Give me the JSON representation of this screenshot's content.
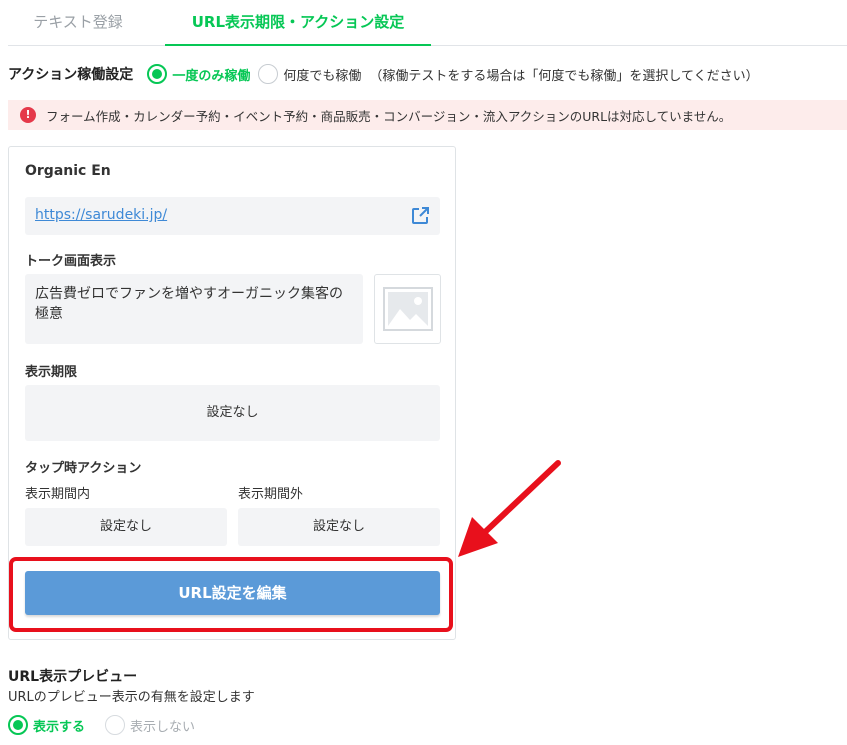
{
  "tabs": [
    {
      "label": "テキスト登録",
      "active": false
    },
    {
      "label": "URL表示期限・アクション設定",
      "active": true
    }
  ],
  "action_setting": {
    "title": "アクション稼働設定",
    "options": [
      {
        "label": "一度のみ稼働",
        "selected": true
      },
      {
        "label": "何度でも稼働",
        "selected": false
      }
    ],
    "hint": "（稼働テストをする場合は「何度でも稼働」を選択してください）"
  },
  "warning": {
    "icon": "exclamation-icon",
    "text": "フォーム作成・カレンダー予約・イベント予約・商品販売・コンバージョン・流入アクションのURLは対応していません。"
  },
  "card": {
    "title": "Organic En",
    "url": "https://sarudeki.jp/",
    "talk_label": "トーク画面表示",
    "talk_text": "広告費ゼロでファンを増やすオーガニック集客の極意",
    "period_label": "表示期限",
    "period_value": "設定なし",
    "tap_action_label": "タップ時アクション",
    "inside_label": "表示期間内",
    "inside_value": "設定なし",
    "outside_label": "表示期間外",
    "outside_value": "設定なし",
    "edit_button": "URL設定を編集"
  },
  "preview": {
    "title": "URL表示プレビュー",
    "description": "URLのプレビュー表示の有無を設定します",
    "options": [
      {
        "label": "表示する",
        "selected": true
      },
      {
        "label": "表示しない",
        "selected": false
      }
    ]
  },
  "colors": {
    "accent_green": "#06c755",
    "button_blue": "#5b9ad8",
    "link_blue": "#3e89d6",
    "warning_bg": "#fdeceb",
    "annotation_red": "#e8101c"
  }
}
